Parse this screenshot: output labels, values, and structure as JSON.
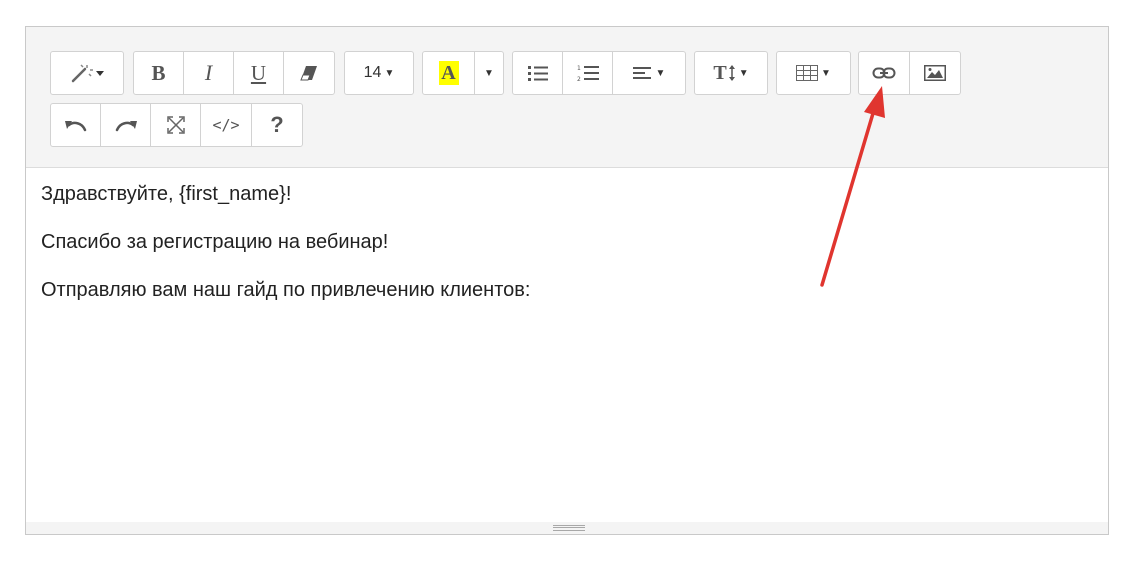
{
  "toolbar": {
    "font_size_label": "14",
    "highlight_letter": "A",
    "code_label": "</>",
    "help_label": "?",
    "text_size_letter": "T",
    "icons": {
      "magic": "magic-wand-icon",
      "bold": "bold-icon",
      "italic": "italic-icon",
      "underline": "underline-icon",
      "eraser": "eraser-icon",
      "bullet_list": "bullet-list-icon",
      "ordered_list": "ordered-list-icon",
      "align": "align-left-icon",
      "table": "table-icon",
      "link": "link-icon",
      "image": "image-icon",
      "undo": "undo-icon",
      "redo": "redo-icon",
      "fullscreen": "fullscreen-icon"
    },
    "labels": {
      "bold": "B",
      "italic": "I",
      "underline": "U"
    }
  },
  "content": {
    "lines": [
      "Здравствуйте, {first_name}!",
      "Спасибо за регистрацию на вебинар!",
      "Отправляю вам наш гайд по привлечению клиентов:"
    ]
  },
  "colors": {
    "annotation_arrow": "#e0352f",
    "highlight": "#ffff00",
    "toolbar_bg": "#f4f4f4"
  }
}
